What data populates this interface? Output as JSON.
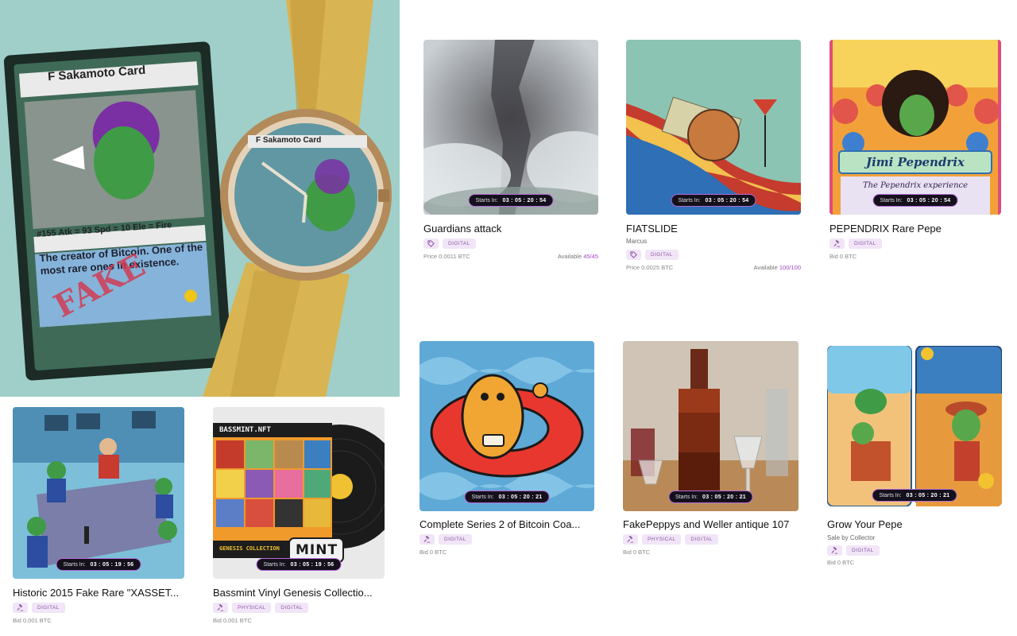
{
  "timer_label": "Starts In:",
  "colors": {
    "accent": "#a347c9",
    "tag_bg": "#f1e5f7",
    "timer_border": "#b46ad9"
  },
  "hero": {
    "card_title": "F Sakamoto Card",
    "card_stats": "#155 Atk = 93 Spd = 10 Ele = Fire",
    "card_text": "The creator of Bitcoin. One of the most rare ones in existence.",
    "card_stamp": "FAKE",
    "watch_label": "F Sakamoto Card"
  },
  "items": [
    {
      "id": "guardians",
      "title": "Guardians attack",
      "creator": "",
      "type_icon": "tag-icon",
      "tags": [
        "DIGITAL"
      ],
      "price_text": "Price 0.0011 BTC",
      "available_label": "Available",
      "available_value": "45/45",
      "timer": "03 : 05 : 20 : 54"
    },
    {
      "id": "fiatslide",
      "title": "FIATSLIDE",
      "creator": "Marcus",
      "type_icon": "tag-icon",
      "tags": [
        "DIGITAL"
      ],
      "price_text": "Price 0.0025 BTC",
      "available_label": "Available",
      "available_value": "100/100",
      "timer": "03 : 05 : 20 : 54"
    },
    {
      "id": "pependrix",
      "title": "PEPENDRIX Rare Pepe",
      "creator": "",
      "type_icon": "gavel-icon",
      "tags": [
        "DIGITAL"
      ],
      "price_text": "Bid 0 BTC",
      "timer": "03 : 05 : 20 : 54",
      "art_banner": "Jimi Pependrix",
      "art_caption": "The Pependrix experience"
    },
    {
      "id": "bitcoin-coaster",
      "title": "Complete Series 2 of Bitcoin Coa...",
      "creator": "",
      "type_icon": "gavel-icon",
      "tags": [
        "DIGITAL"
      ],
      "price_text": "Bid 0 BTC",
      "timer": "03 : 05 : 20 : 21"
    },
    {
      "id": "fakepeppys",
      "title": "FakePeppys and Weller antique 107",
      "creator": "",
      "type_icon": "gavel-icon",
      "tags": [
        "PHYSICAL",
        "DIGITAL"
      ],
      "price_text": "Bid 0 BTC",
      "timer": "03 : 05 : 20 : 21"
    },
    {
      "id": "grow-pepe",
      "title": "Grow Your Pepe",
      "creator": "Sale by Collector",
      "type_icon": "gavel-icon",
      "tags": [
        "DIGITAL"
      ],
      "price_text": "Bid 0 BTC",
      "timer": "03 : 05 : 20 : 21"
    },
    {
      "id": "historic-2015",
      "title": "Historic 2015 Fake Rare \"XASSET...",
      "creator": "",
      "type_icon": "gavel-icon",
      "tags": [
        "DIGITAL"
      ],
      "price_text": "Bid 0.001 BTC",
      "timer": "03 : 05 : 19 : 56"
    },
    {
      "id": "bassmint",
      "title": "Bassmint Vinyl Genesis Collectio...",
      "creator": "",
      "type_icon": "gavel-icon",
      "tags": [
        "PHYSICAL",
        "DIGITAL"
      ],
      "price_text": "Bid 0.001 BTC",
      "timer": "03 : 05 : 19 : 56",
      "art_header": "BASSMINT.NFT",
      "art_footer": "GENESIS COLLECTION",
      "art_logo": "MINT"
    }
  ]
}
